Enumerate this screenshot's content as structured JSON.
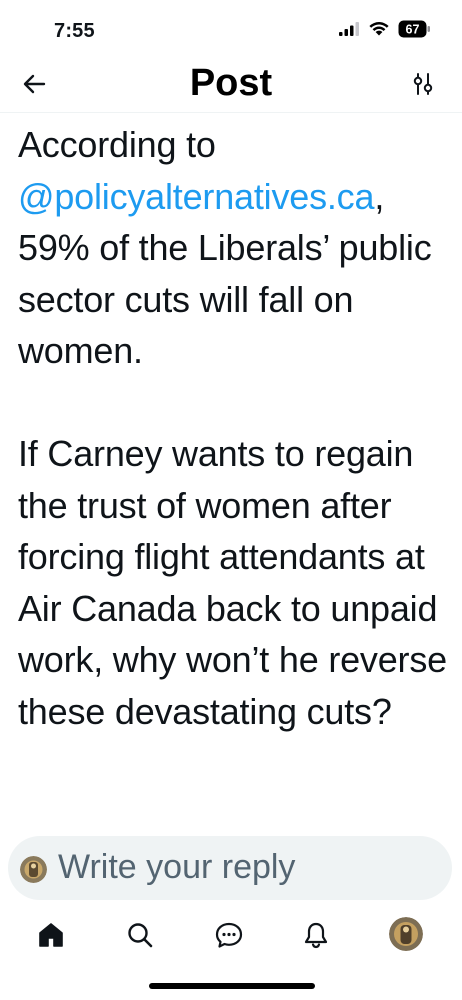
{
  "status_bar": {
    "time": "7:55",
    "battery_level": "67"
  },
  "header": {
    "title": "Post"
  },
  "post": {
    "paragraph1_prefix": "According to ",
    "mention": "@policyalternatives.ca",
    "paragraph1_suffix": ", 59% of the Liberals’ public sector cuts will fall on women.",
    "paragraph2": "If Carney wants to regain the trust of women after forcing flight attendants at Air Canada back to unpaid work, why won’t he reverse these devastating cuts?"
  },
  "reply": {
    "placeholder": "Write your reply"
  },
  "colors": {
    "accent": "#1d9bf0",
    "text": "#0f1419",
    "muted": "#536471",
    "reply_bg": "#eff3f4"
  },
  "icons": {
    "back": "arrow-left-icon",
    "tune": "sliders-icon",
    "home": "home-icon",
    "search": "search-icon",
    "messages": "chat-bubble-icon",
    "notifications": "bell-icon",
    "profile": "avatar"
  }
}
